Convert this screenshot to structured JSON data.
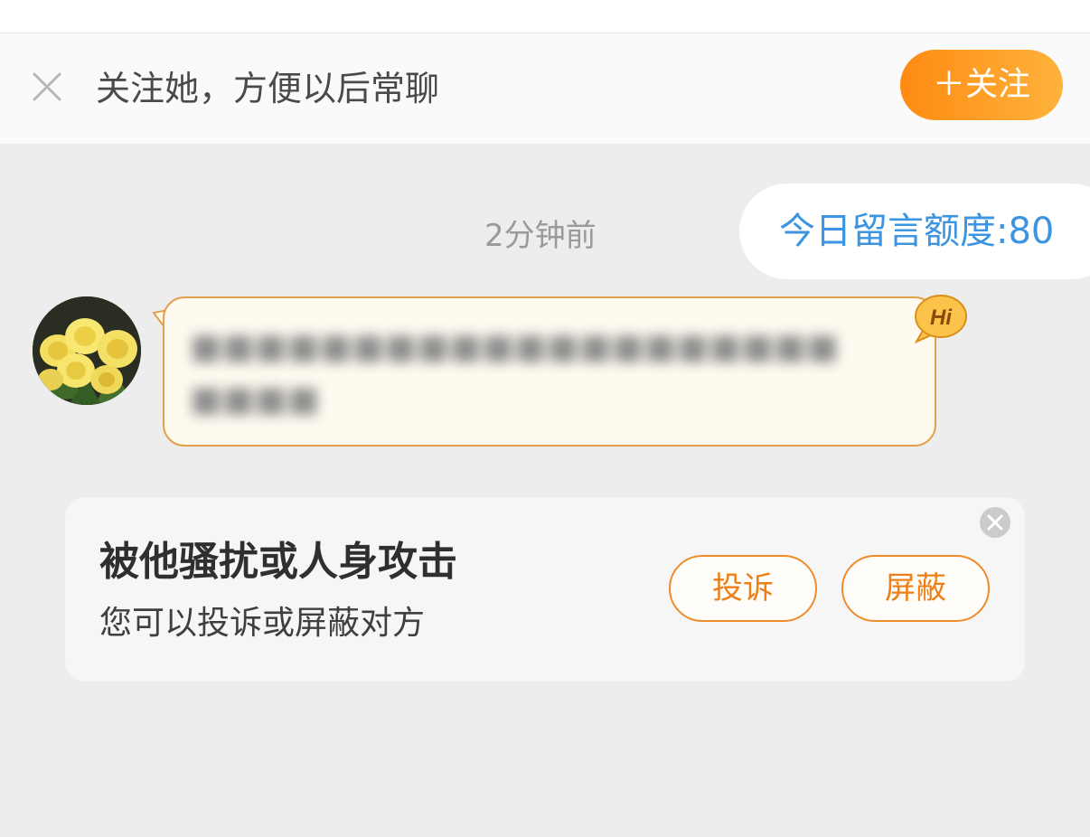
{
  "follow_bar": {
    "text": "关注她，方便以后常聊",
    "follow_button": "＋关注",
    "close_icon": "close-icon"
  },
  "chat": {
    "timestamp": "2分钟前",
    "quota_text": "今日留言额度:80",
    "message": {
      "sender_avatar": "yellow-rose-bouquet",
      "text_blurred": true,
      "badge": "Hi"
    }
  },
  "report_card": {
    "title": "被他骚扰或人身攻击",
    "subtitle": "您可以投诉或屏蔽对方",
    "report_button": "投诉",
    "block_button": "屏蔽",
    "close_icon": "close-circle-icon"
  },
  "colors": {
    "accent_orange": "#ff8a12",
    "accent_yellow": "#fdb33c",
    "quota_blue": "#3d94e0",
    "bubble_border": "#e2a04a",
    "button_text": "#ee7f17"
  }
}
